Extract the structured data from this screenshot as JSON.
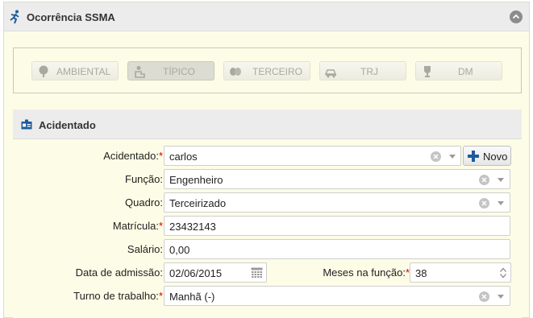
{
  "header": {
    "title": "Ocorrência SSMA"
  },
  "types": [
    {
      "label": "AMBIENTAL",
      "icon": "tree-icon",
      "active": false
    },
    {
      "label": "TÍPICO",
      "icon": "person-desk-icon",
      "active": true
    },
    {
      "label": "TERCEIRO",
      "icon": "handshake-icon",
      "active": false
    },
    {
      "label": "TRJ",
      "icon": "car-crash-icon",
      "active": false
    },
    {
      "label": "DM",
      "icon": "trophy-icon",
      "active": false
    }
  ],
  "section": {
    "title": "Acidentado"
  },
  "form": {
    "acidentado": {
      "label": "Acidentado:",
      "value": "carlos",
      "required": "*"
    },
    "novo_label": "Novo",
    "funcao": {
      "label": "Função:",
      "value": "Engenheiro"
    },
    "quadro": {
      "label": "Quadro:",
      "value": "Terceirizado"
    },
    "matricula": {
      "label": "Matrícula:",
      "value": "23432143",
      "required": "*"
    },
    "salario": {
      "label": "Salário:",
      "value": "0,00"
    },
    "data_admissao": {
      "label": "Data de admissão:",
      "value": "02/06/2015"
    },
    "meses_funcao": {
      "label": "Meses na função:",
      "value": "38",
      "required": "*"
    },
    "turno": {
      "label": "Turno de trabalho:",
      "value": "Manhã (-)",
      "required": "*"
    }
  },
  "colors": {
    "required": "#cc0000",
    "accent": "#1e5b9c",
    "panel_bg": "#fdfce6"
  }
}
